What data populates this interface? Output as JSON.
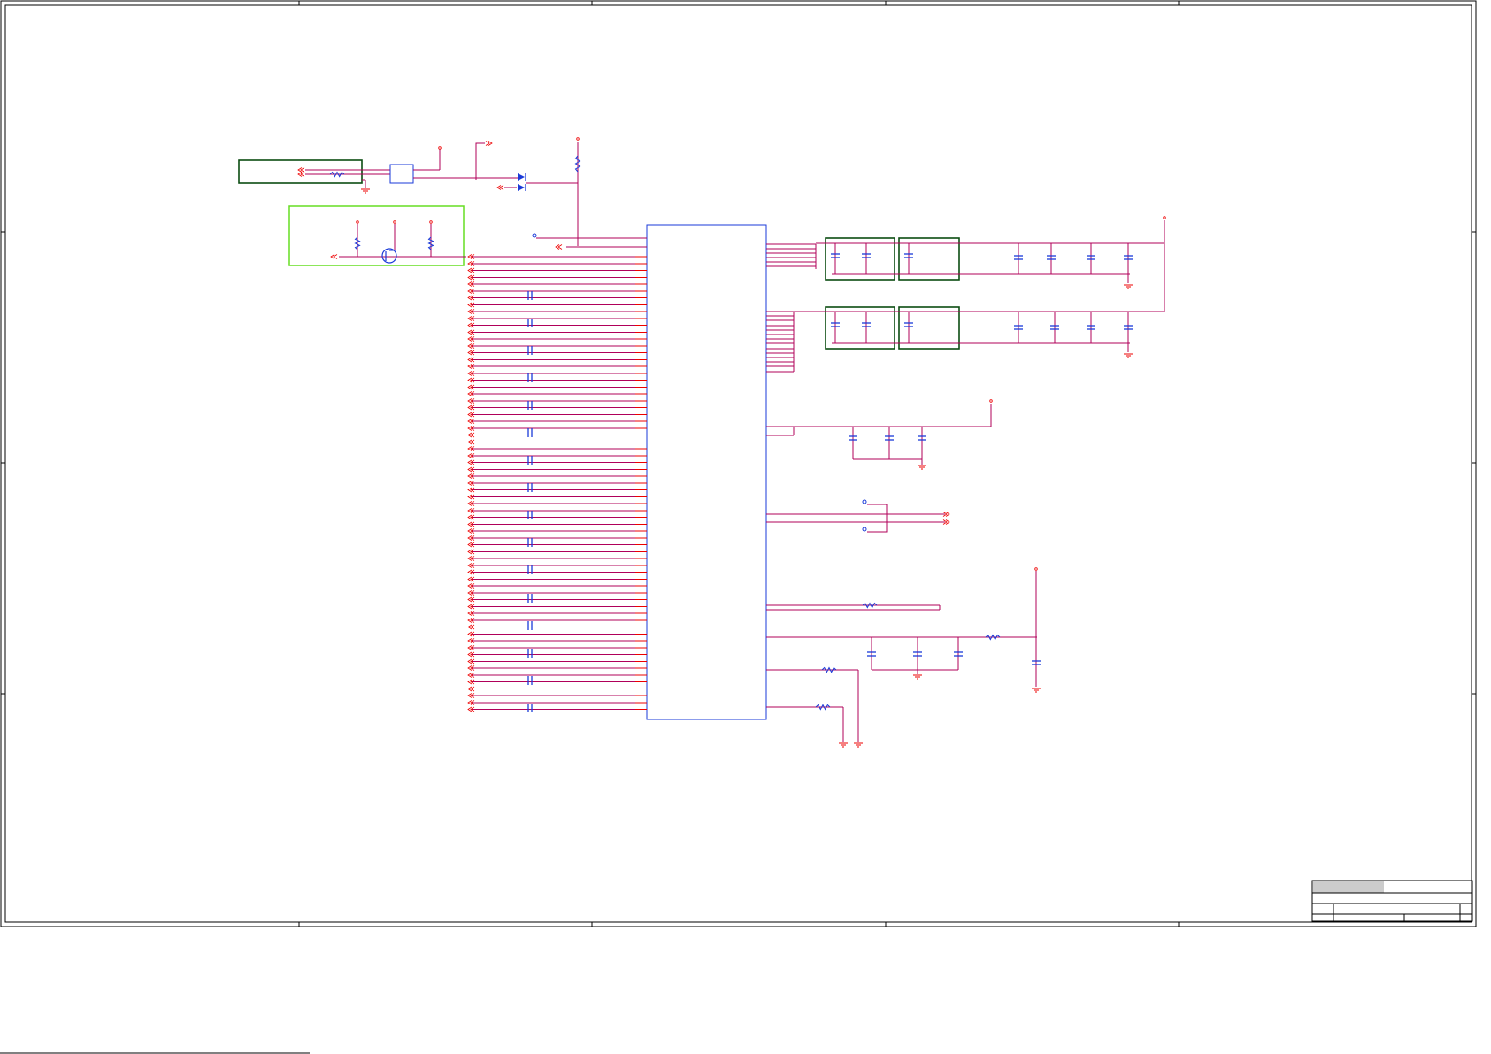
{
  "title_block": {
    "title": "",
    "doc_number": "",
    "sheet": "",
    "revision": ""
  },
  "colors": {
    "wire": "#b0005a",
    "pin": "#ee0000",
    "component": "#1a3ad8",
    "frame": "#000000",
    "group_box": "#0b4d12",
    "highlight_box": "#66dd22",
    "titleblock_fill": "#cccccc"
  },
  "legend": []
}
